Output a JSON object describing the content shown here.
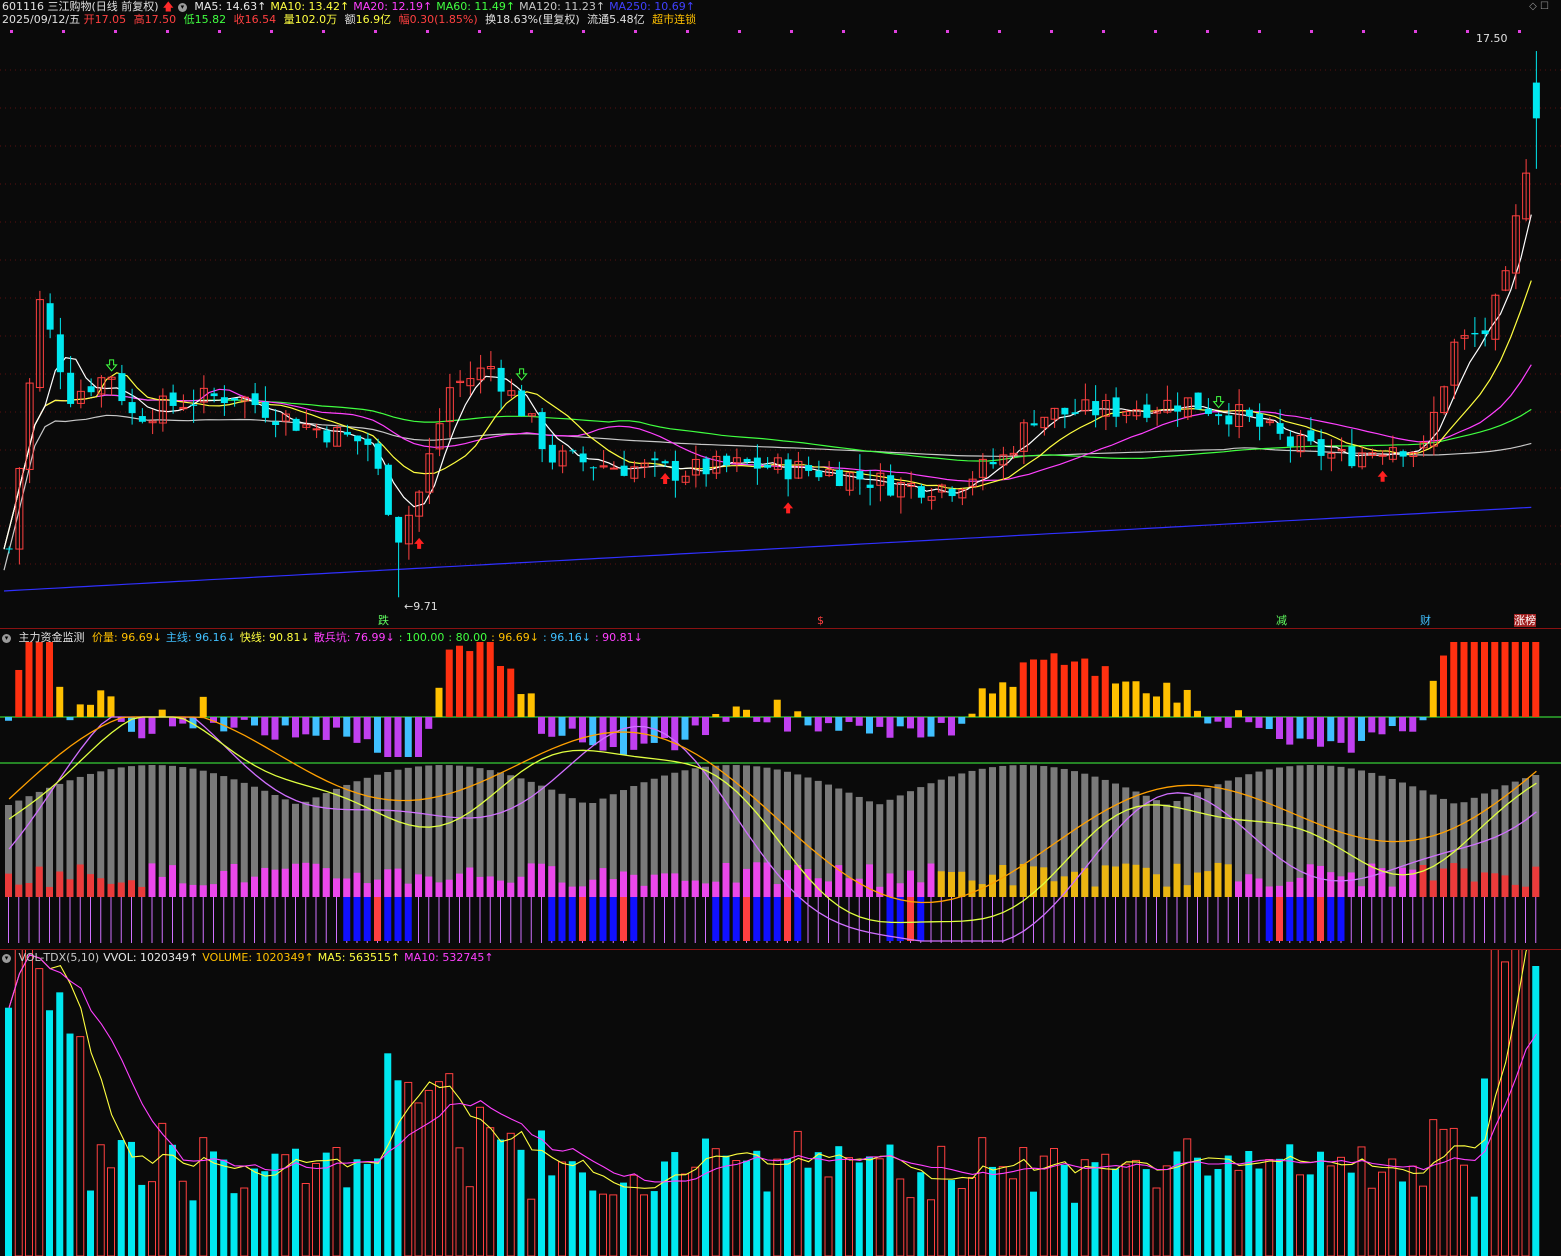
{
  "stock": {
    "code_name": "601116 三江购物(日线 前复权)",
    "date": "2025/09/12/五",
    "open_label": "开",
    "open": "17.05",
    "high_label": "高",
    "high": "17.50",
    "low_label": "低",
    "low": "15.82",
    "close_label": "收",
    "close": "16.54",
    "vol_label": "量",
    "vol": "102.0万",
    "amt_label": "额",
    "amt": "16.9亿",
    "chg_label": "幅",
    "chg": "0.30(1.85%)",
    "turnover": "换18.63%(里复权)",
    "float_cap": "流通5.48亿",
    "status": "超市连锁"
  },
  "ma_legend": [
    {
      "text": "MA5: 14.63↑",
      "color": "#e8e8e8"
    },
    {
      "text": "MA10: 13.42↑",
      "color": "#ffff40"
    },
    {
      "text": "MA20: 12.19↑",
      "color": "#ff40ff"
    },
    {
      "text": "MA60: 11.49↑",
      "color": "#40ff40"
    },
    {
      "text": "MA120: 11.23↑",
      "color": "#c8c8c8"
    },
    {
      "text": "MA250: 10.69↑",
      "color": "#4040ff"
    }
  ],
  "price_markers": {
    "high_price": "17.50",
    "low_price": "←9.71",
    "tags": [
      {
        "text": "跌",
        "color": "#60ff60"
      },
      {
        "text": "$",
        "color": "#ff4040"
      },
      {
        "text": "减",
        "color": "#60ff60"
      },
      {
        "text": "财",
        "color": "#40c0ff"
      },
      {
        "text": "涨榜",
        "color": "#ffffff"
      }
    ]
  },
  "indicator": {
    "title": "主力资金监测",
    "items": [
      {
        "text": "价量: 96.69↓",
        "color": "#ffc000"
      },
      {
        "text": "主线: 96.16↓",
        "color": "#40c0ff"
      },
      {
        "text": "快线: 90.81↓",
        "color": "#ffff40"
      },
      {
        "text": "散兵坑: 76.99↓",
        "color": "#ff40ff"
      },
      {
        "text": ": 100.00",
        "color": "#40ff40"
      },
      {
        "text": ": 80.00",
        "color": "#40ff40"
      },
      {
        "text": ": 96.69↓",
        "color": "#ffc000"
      },
      {
        "text": ": 96.16↓",
        "color": "#40c0ff"
      },
      {
        "text": ": 90.81↓",
        "color": "#ff40ff"
      }
    ]
  },
  "volume": {
    "items": [
      {
        "text": "VOL-TDX(5,10)",
        "color": "#c8c8c8"
      },
      {
        "text": "VVOL: 1020349↑",
        "color": "#e8e8e8"
      },
      {
        "text": "VOLUME: 1020349↑",
        "color": "#ffc000"
      },
      {
        "text": "MA5: 563515↑",
        "color": "#ffff40"
      },
      {
        "text": "MA10: 532745↑",
        "color": "#ff40ff"
      }
    ]
  },
  "colors": {
    "up": "#ff4040",
    "down": "#00e8f0",
    "background": "#0a0a0a"
  },
  "chart_data": {
    "type": "candlestick",
    "last_candle": {
      "open": 17.05,
      "high": 17.5,
      "low": 15.82,
      "close": 16.54
    },
    "period_low": 9.71,
    "period_high": 17.5
  }
}
